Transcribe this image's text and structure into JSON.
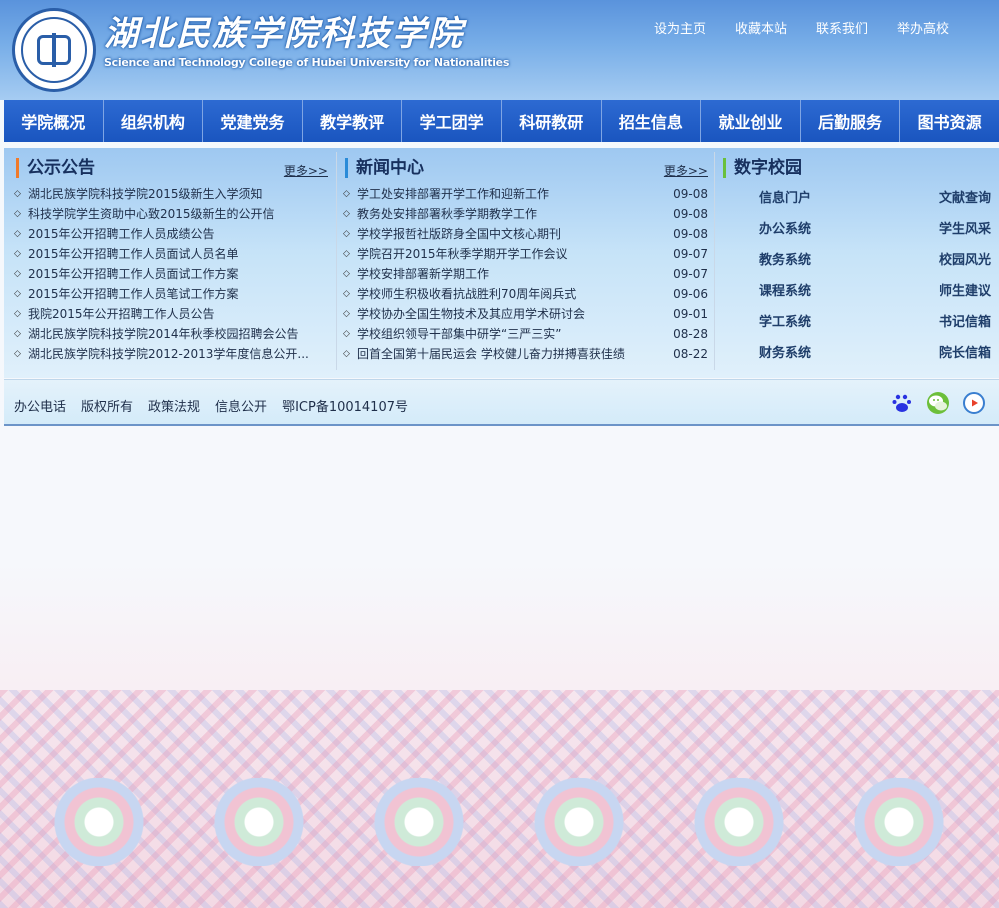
{
  "header": {
    "school_name_cn": "湖北民族学院科技学院",
    "school_name_en": "Science and Technology College of Hubei University for Nationalities",
    "top_links": [
      "设为主页",
      "收藏本站",
      "联系我们",
      "举办高校"
    ]
  },
  "nav": {
    "items": [
      "学院概况",
      "组织机构",
      "党建党务",
      "教学教评",
      "学工团学",
      "科研教研",
      "招生信息",
      "就业创业",
      "后勤服务",
      "图书资源"
    ]
  },
  "notice": {
    "title": "公示公告",
    "more": "更多>>",
    "items": [
      "湖北民族学院科技学院2015级新生入学须知",
      "科技学院学生资助中心致2015级新生的公开信",
      "2015年公开招聘工作人员成绩公告",
      "2015年公开招聘工作人员面试人员名单",
      "2015年公开招聘工作人员面试工作方案",
      "2015年公开招聘工作人员笔试工作方案",
      "我院2015年公开招聘工作人员公告",
      "湖北民族学院科技学院2014年秋季校园招聘会公告",
      "湖北民族学院科技学院2012-2013学年度信息公开..."
    ]
  },
  "news": {
    "title": "新闻中心",
    "more": "更多>>",
    "items": [
      {
        "text": "学工处安排部署开学工作和迎新工作",
        "date": "09-08"
      },
      {
        "text": "教务处安排部署秋季学期教学工作",
        "date": "09-08"
      },
      {
        "text": "学校学报哲社版跻身全国中文核心期刊",
        "date": "09-08"
      },
      {
        "text": "学院召开2015年秋季学期开学工作会议",
        "date": "09-07"
      },
      {
        "text": "学校安排部署新学期工作",
        "date": "09-07"
      },
      {
        "text": "学校师生积极收看抗战胜利70周年阅兵式",
        "date": "09-06"
      },
      {
        "text": "学校协办全国生物技术及其应用学术研讨会",
        "date": "09-01"
      },
      {
        "text": "学校组织领导干部集中研学“三严三实”",
        "date": "08-28"
      },
      {
        "text": "回首全国第十届民运会 学校健儿奋力拼搏喜获佳绩",
        "date": "08-22"
      }
    ]
  },
  "digital": {
    "title": "数字校园",
    "links": [
      "信息门户",
      "文献查询",
      "办公系统",
      "学生风采",
      "教务系统",
      "校园风光",
      "课程系统",
      "师生建议",
      "学工系统",
      "书记信箱",
      "财务系统",
      "院长信箱"
    ]
  },
  "footer": {
    "links": [
      "办公电话",
      "版权所有",
      "政策法规",
      "信息公开",
      "鄂ICP备10014107号"
    ],
    "icons": [
      "baidu-icon",
      "wechat-icon",
      "video-play-icon"
    ]
  },
  "colors": {
    "nav_bg": "#1a55bf",
    "header_bg": "#5a93dc",
    "notice_accent": "#f07a2a",
    "news_accent": "#2a8bd8",
    "digital_accent": "#6ac03c"
  }
}
